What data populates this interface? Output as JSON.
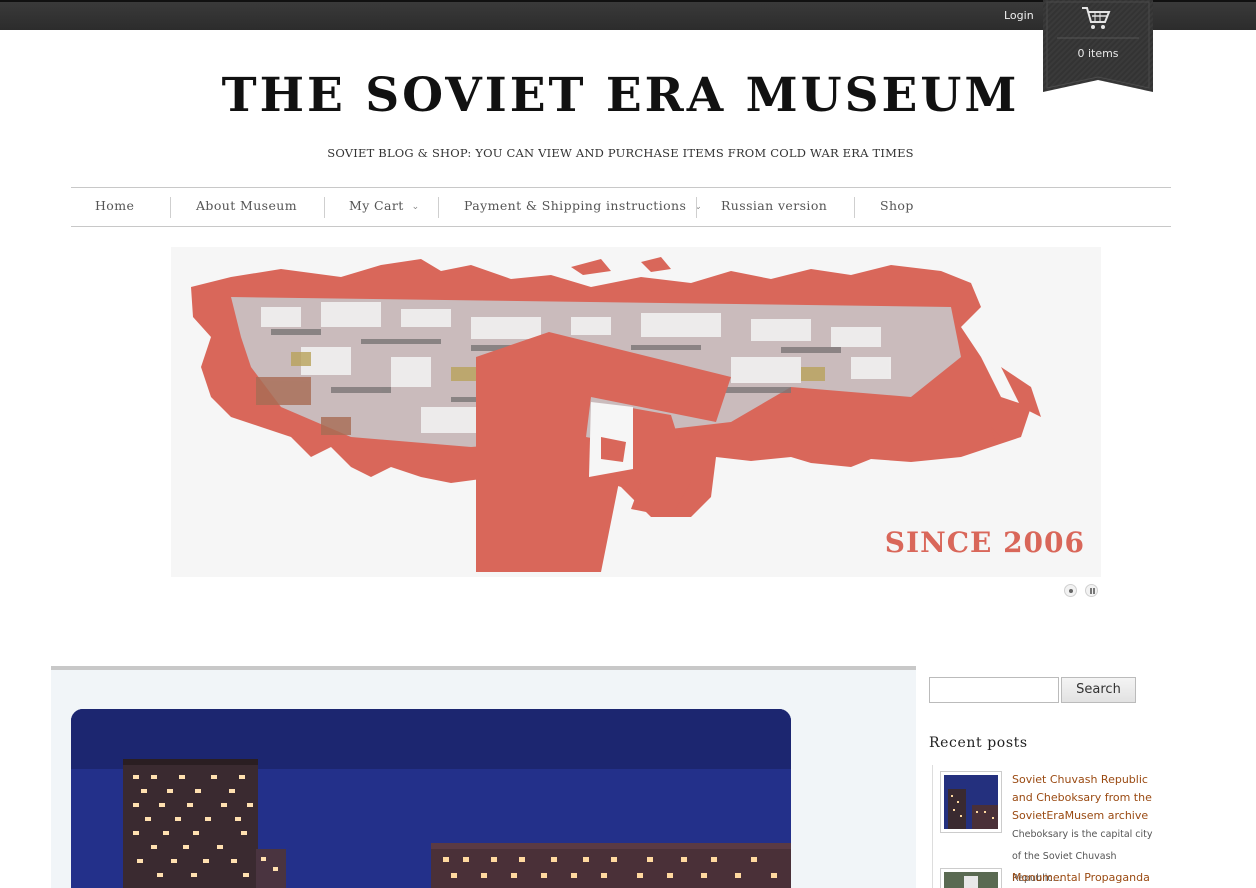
{
  "topbar": {
    "login_label": "Login",
    "cart_count": "0 items",
    "cart_icon": "shopping-cart-icon"
  },
  "header": {
    "title": "THE SOVIET ERA MUSEUM",
    "tagline": "SOVIET BLOG & SHOP: YOU CAN VIEW AND PURCHASE ITEMS FROM COLD WAR ERA TIMES"
  },
  "nav": {
    "items": [
      {
        "label": "Home"
      },
      {
        "label": "About Museum"
      },
      {
        "label": "My Cart",
        "has_dropdown": true
      },
      {
        "label": "Payment & Shipping instructions",
        "has_dropdown": true
      },
      {
        "label": "Russian version"
      },
      {
        "label": "Shop"
      }
    ]
  },
  "slider": {
    "caption": "SINCE 2006",
    "accent_color": "#d9675a"
  },
  "sidebar": {
    "search_placeholder": "",
    "search_button": "Search",
    "recent_posts_title": "Recent posts",
    "recent_posts": [
      {
        "title": "Soviet Chuvash Republic and Cheboksary from the SovietEraMusem archive",
        "excerpt": "Cheboksary is the capital city of the Soviet Chuvash Republic..."
      },
      {
        "title": "Monumental Propaganda in",
        "excerpt": ""
      }
    ]
  },
  "colors": {
    "link": "#9a4a12",
    "topbar": "#333333"
  }
}
